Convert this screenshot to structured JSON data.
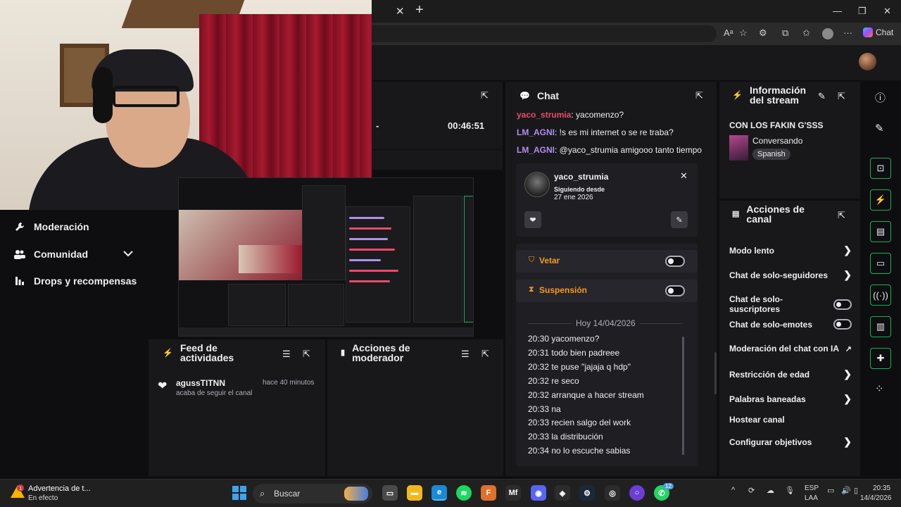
{
  "browser": {
    "tab_close": "✕",
    "tab_new": "+",
    "window_controls": [
      "—",
      "❐",
      "✕"
    ],
    "toolbar_icons": [
      "read-aloud-icon",
      "star-icon",
      "extensions-icon",
      "apps-icon",
      "favorites-icon",
      "collections-icon",
      "profile-icon",
      "more-icon"
    ],
    "copilot_label": "Chat"
  },
  "left_nav": {
    "items": [
      {
        "label": "Moderación",
        "icon": "wrench-icon"
      },
      {
        "label": "Comunidad",
        "icon": "people-icon"
      },
      {
        "label": "Drops y recompensas",
        "icon": "gift-icon"
      }
    ]
  },
  "stats": {
    "value_left": "-",
    "value_right": "00:46:51"
  },
  "feed": {
    "title": "Feed de actividades",
    "entries": [
      {
        "user": "agussTITNN",
        "action": "acaba de seguir el canal",
        "time": "hace 40 minutos"
      }
    ]
  },
  "mod_actions": {
    "title": "Acciones de moderador"
  },
  "chat": {
    "title": "Chat",
    "messages": [
      {
        "user": "yaco_strumia",
        "text": ": yacomenzo?",
        "color": "#e84c6a"
      },
      {
        "user": "LM_AGNI",
        "text": ": !s es mi internet o se re traba?",
        "color": "#b38ef0"
      },
      {
        "user": "LM_AGNI",
        "text": ": @yaco_strumia amigooo tanto tiempo",
        "color": "#b38ef0"
      }
    ],
    "card": {
      "username": "yaco_strumia",
      "following_label": "Siguiendo desde",
      "following_date": "27 ene 2026"
    },
    "ban_label": "Vetar",
    "timeout_label": "Suspensión",
    "history_date": "Hoy 14/04/2026",
    "history": [
      "20:30 yacomenzo?",
      "20:31 todo bien padreee",
      "20:32 te puse \"jajaja q hdp\"",
      "20:32 re seco",
      "20:32 arranque a hacer stream",
      "20:33 na",
      "20:33 recien salgo del work",
      "20:33 la distribución",
      "20:34 no lo escuche sabias"
    ]
  },
  "stream_info": {
    "title": "Información del stream",
    "stream_title": "CON LOS FAKIN G'SSS",
    "category": "Conversando",
    "language": "Spanish"
  },
  "channel_actions": {
    "title": "Acciones de canal",
    "rows": [
      {
        "label": "Modo lento",
        "control": "chevron"
      },
      {
        "label": "Chat de solo-seguidores",
        "control": "chevron"
      },
      {
        "label": "Chat de solo-suscriptores",
        "control": "toggle"
      },
      {
        "label": "Chat de solo-emotes",
        "control": "toggle"
      },
      {
        "label": "Moderación del chat con IA",
        "control": "external"
      },
      {
        "label": "Restricción de edad",
        "control": "chevron"
      },
      {
        "label": "Palabras baneadas",
        "control": "chevron"
      },
      {
        "label": "Hostear canal",
        "control": "none"
      },
      {
        "label": "Configurar objetivos",
        "control": "chevron"
      }
    ]
  },
  "taskbar": {
    "notification_title": "Advertencia de t...",
    "notification_sub": "En efecto",
    "search_placeholder": "Buscar",
    "language": "ESP",
    "layout": "LAA",
    "time": "20:35",
    "date": "14/4/2026",
    "whatsapp_badge": "12"
  },
  "colors": {
    "panel": "#18181b",
    "background": "#0e0e10",
    "accent_orange": "#f59a23",
    "rail_green": "#1aad60"
  }
}
